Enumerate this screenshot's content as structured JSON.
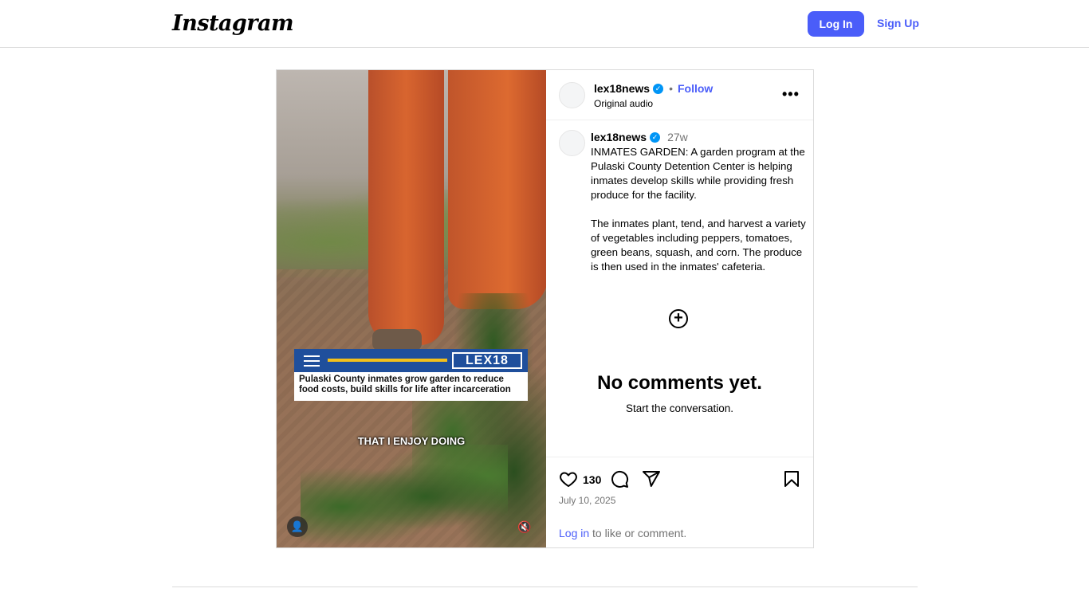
{
  "nav": {
    "logo": "Instagram",
    "login_label": "Log In",
    "signup_label": "Sign Up"
  },
  "media": {
    "lower_third_logo": "LEX18",
    "lower_third_headline": "Pulaski County inmates grow garden to reduce food costs, build skills for life after incarceration",
    "subtitle": "THAT I ENJOY DOING",
    "user_icon": "👤",
    "mute_icon": "🔇"
  },
  "post_header": {
    "username": "lex18news",
    "verified_icon": "✓",
    "separator": "•",
    "follow_label": "Follow",
    "audio": "Original audio",
    "more_icon": "•••"
  },
  "caption": {
    "username": "lex18news",
    "verified_icon": "✓",
    "time": "27w",
    "paragraph1": "INMATES GARDEN: A garden program at the Pulaski County Detention Center is helping inmates develop skills while providing fresh produce for the facility.",
    "paragraph2": "The inmates plant, tend, and harvest a variety of vegetables including peppers, tomatoes, green beans, squash, and corn. The produce is then used in the inmates' cafeteria."
  },
  "comments": {
    "add_icon": "+",
    "empty_title": "No comments yet.",
    "empty_subtitle": "Start the conversation."
  },
  "actions": {
    "likes": "130",
    "date": "July 10, 2025",
    "login_link": "Log in",
    "login_suffix": " to like or comment."
  }
}
